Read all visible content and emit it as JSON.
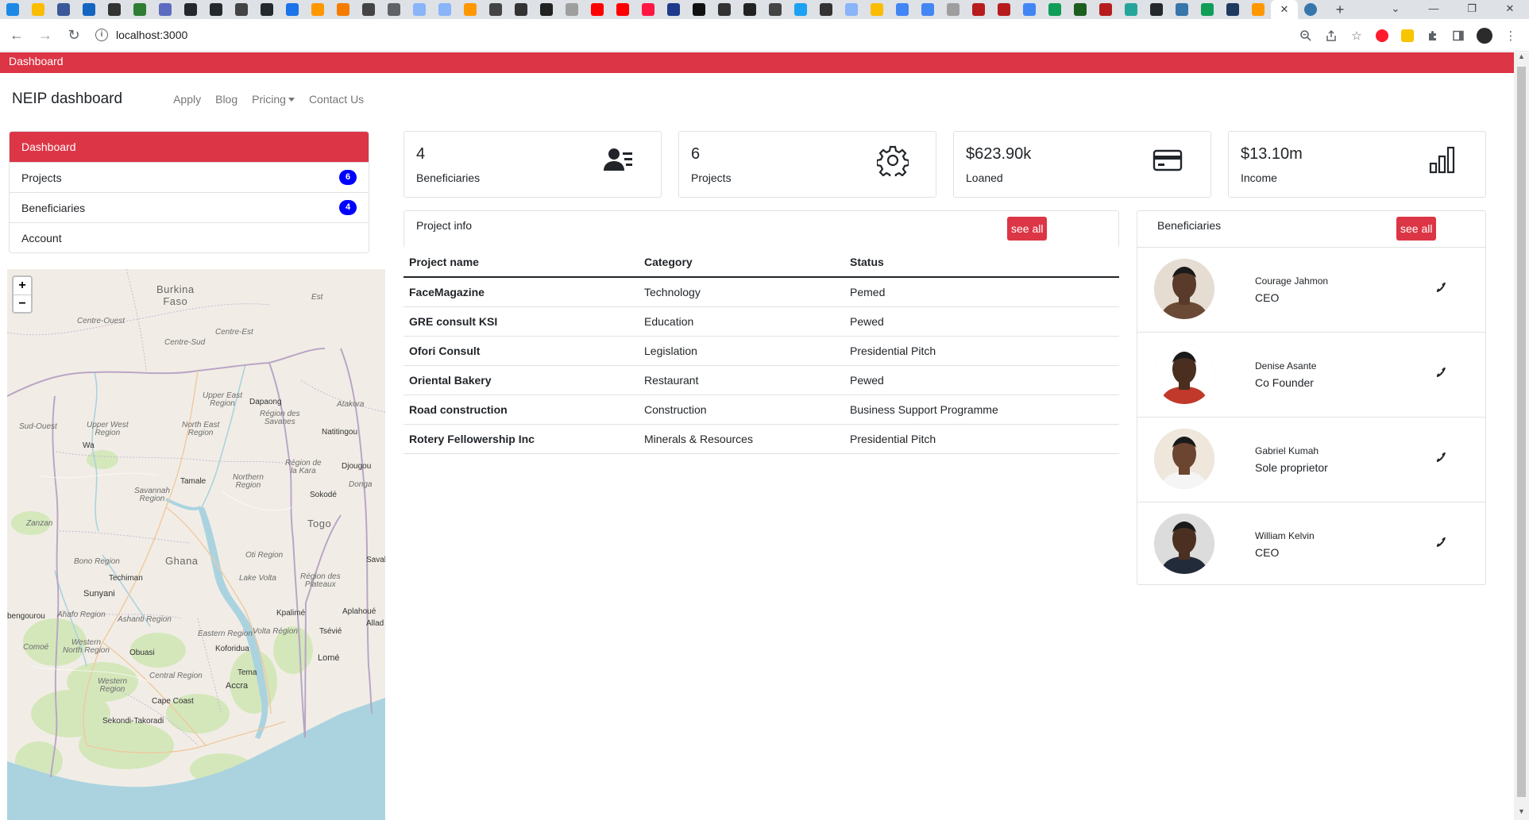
{
  "browser": {
    "url": "localhost:3000",
    "active_tab_close": "✕",
    "new_tab": "+",
    "window_controls": [
      "⌄",
      "—",
      "❐",
      "✕"
    ],
    "tab_colors": [
      "#1e88e5",
      "#fbbc04",
      "#3b5998",
      "#1565c0",
      "#333333",
      "#2e7d32",
      "#5c6bc0",
      "#24292e",
      "#24292e",
      "#444444",
      "#24292e",
      "#1a73e8",
      "#ff9800",
      "#f57c00",
      "#444444",
      "#5f6368",
      "#8ab4f8",
      "#8ab4f8",
      "#ff9800",
      "#444444",
      "#333333",
      "#222222",
      "#9e9e9e",
      "#ff0000",
      "#ff0000",
      "#ff1744",
      "#1e3a8a",
      "#111111",
      "#333333",
      "#222222",
      "#444444",
      "#1da1f2",
      "#333333",
      "#8ab4f8",
      "#fbbc04",
      "#4285f4",
      "#4285f4",
      "#9e9e9e",
      "#b71c1c",
      "#b71c1c",
      "#4285f4",
      "#0f9d58",
      "#1b5e20",
      "#b71c1c",
      "#26a69a",
      "#24292e",
      "#3776ab",
      "#0f9d58",
      "#1e3a5f",
      "#ff9800"
    ]
  },
  "topbar": {
    "title": "Dashboard"
  },
  "navbar": {
    "brand": "NEIP dashboard",
    "links": {
      "apply": "Apply",
      "blog": "Blog",
      "pricing": "Pricing",
      "contact": "Contact Us"
    }
  },
  "sidebar": {
    "items": [
      {
        "label": "Dashboard",
        "badge": ""
      },
      {
        "label": "Projects",
        "badge": "6"
      },
      {
        "label": "Beneficiaries",
        "badge": "4"
      },
      {
        "label": "Account",
        "badge": ""
      }
    ]
  },
  "map": {
    "zoom_in": "+",
    "zoom_out": "−",
    "labels": {
      "burkina": "Burkina\nFaso",
      "centre_ouest": "Centre-Ouest",
      "centre_est": "Centre-Est",
      "centre_sud": "Centre-Sud",
      "est": "Est",
      "upper_east": "Upper East\nRegion",
      "dapaong": "Dapaong",
      "region_savanes": "Région des\nSavanes",
      "atakora": "Atakora",
      "sud_ouest": "Sud-Ouest",
      "upper_west": "Upper West\nRegion",
      "north_east": "North East\nRegion",
      "natitingou": "Natitingou",
      "wa": "Wa",
      "region_kara": "Région de\nla Kara",
      "djougou": "Djougou",
      "tamale": "Tamale",
      "northern": "Northern\nRegion",
      "donga": "Donga",
      "savannah": "Savannah\nRegion",
      "sokode": "Sokodé",
      "zanzan": "Zanzan",
      "togo": "Togo",
      "ghana": "Ghana",
      "oti": "Oti Region",
      "bono": "Bono Region",
      "techiman": "Techiman",
      "sava": "Saval",
      "region_plateaux": "Région des\nPlateaux",
      "sunyani": "Sunyani",
      "lake_volta": "Lake Volta",
      "ahafo": "Ahafo Region",
      "kpalime": "Kpalimé",
      "aplahoue": "Aplahoué",
      "bengourou": "bengourou",
      "ashanti": "Ashanti Region",
      "allad": "Allad",
      "eastern": "Eastern Region",
      "volta": "Volta Région",
      "tsevie": "Tsévié",
      "comoe": "Comoé",
      "western_north": "Western\nNorth Region",
      "koforidua": "Koforidua",
      "obuasi": "Obuasi",
      "lome": "Lomé",
      "central": "Central Region",
      "tema": "Tema",
      "western": "Western\nRegion",
      "accra": "Accra",
      "cape_coast": "Cape Coast",
      "sekondi": "Sekondi-Takoradi"
    }
  },
  "stats": [
    {
      "value": "4",
      "label": "Beneficiaries",
      "icon": "user-list-icon"
    },
    {
      "value": "6",
      "label": "Projects",
      "icon": "gear-icon"
    },
    {
      "value": "$623.90k",
      "label": "Loaned",
      "icon": "credit-card-icon"
    },
    {
      "value": "$13.10m",
      "label": "Income",
      "icon": "bar-chart-icon"
    }
  ],
  "project_info": {
    "title": "Project info",
    "see_all": "see all",
    "columns": [
      "Project name",
      "Category",
      "Status"
    ],
    "rows": [
      {
        "name": "FaceMagazine",
        "category": "Technology",
        "status": "Pemed"
      },
      {
        "name": "GRE consult KSI",
        "category": "Education",
        "status": "Pewed"
      },
      {
        "name": "Ofori Consult",
        "category": "Legislation",
        "status": "Presidential Pitch"
      },
      {
        "name": "Oriental Bakery",
        "category": "Restaurant",
        "status": "Pewed"
      },
      {
        "name": "Road construction",
        "category": "Construction",
        "status": "Business Support Programme"
      },
      {
        "name": "Rotery Fellowership Inc",
        "category": "Minerals & Resources",
        "status": "Presidential Pitch"
      }
    ]
  },
  "beneficiaries": {
    "title": "Beneficiaries",
    "see_all": "see all",
    "people": [
      {
        "name": "Courage Jahmon",
        "role": "CEO",
        "skin": "#5a3a2a",
        "bg": "#e6ddd2",
        "shirt": "#6b4a35"
      },
      {
        "name": "Denise Asante",
        "role": "Co Founder",
        "skin": "#4a2e1f",
        "bg": "#ffffff",
        "shirt": "#c0392b"
      },
      {
        "name": "Gabriel Kumah",
        "role": "Sole proprietor",
        "skin": "#6b4530",
        "bg": "#efe6dc",
        "shirt": "#f5f5f5"
      },
      {
        "name": "William Kelvin",
        "role": "CEO",
        "skin": "#4b3022",
        "bg": "#dcdcdc",
        "shirt": "#222b3a"
      }
    ]
  },
  "colors": {
    "accent": "#dc3545",
    "badge": "#0000ff"
  }
}
